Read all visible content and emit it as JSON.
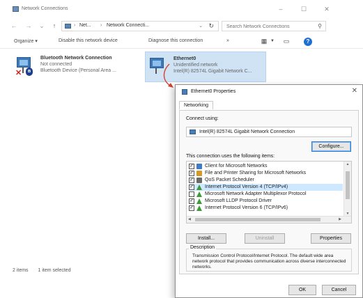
{
  "window": {
    "title": "Network Connections",
    "controls": {
      "minimize": "–",
      "maximize": "☐",
      "close": "✕"
    }
  },
  "nav": {
    "back": "←",
    "forward": "→",
    "recent": "⌄",
    "up": "↑"
  },
  "address": {
    "crumbs": [
      "Net...",
      "Network Connecti..."
    ],
    "separator": "›",
    "dropdown": "⌄",
    "refresh": "↻"
  },
  "search": {
    "placeholder": "Search Network Connections",
    "icon": "search-icon"
  },
  "toolbar": {
    "organize": "Organize ▾",
    "disable": "Disable this network device",
    "diagnose": "Diagnose this connection",
    "more": "»",
    "help": "?"
  },
  "connections": [
    {
      "name": "Bluetooth Network Connection",
      "status": "Not connected",
      "device": "Bluetooth Device (Personal Area ...",
      "icon": "bluetooth-network-icon"
    },
    {
      "name": "Ethernet0",
      "status": "Unidentified network",
      "device": "Intel(R) 82574L Gigabit Network C...",
      "icon": "ethernet-icon"
    }
  ],
  "statusbar": {
    "items_count": "2 items",
    "selected": "1 item selected"
  },
  "dialog": {
    "title": "Ethernet0 Properties",
    "close": "✕",
    "tab": "Networking",
    "connect_using_label": "Connect using:",
    "adapter": "Intel(R) 82574L Gigabit Network Connection",
    "configure_button": "Configure...",
    "items_label": "This connection uses the following items:",
    "items": [
      {
        "label": "Client for Microsoft Networks",
        "checked": true,
        "icon": "client"
      },
      {
        "label": "File and Printer Sharing for Microsoft Networks",
        "checked": true,
        "icon": "share"
      },
      {
        "label": "QoS Packet Scheduler",
        "checked": true,
        "icon": "qos"
      },
      {
        "label": "Internet Protocol Version 4 (TCP/IPv4)",
        "checked": true,
        "icon": "proto",
        "selected": true
      },
      {
        "label": "Microsoft Network Adapter Multiplexor Protocol",
        "checked": false,
        "icon": "proto"
      },
      {
        "label": "Microsoft LLDP Protocol Driver",
        "checked": true,
        "icon": "proto"
      },
      {
        "label": "Internet Protocol Version 6 (TCP/IPv6)",
        "checked": true,
        "icon": "proto"
      }
    ],
    "install_button": "Install...",
    "uninstall_button": "Uninstall",
    "properties_button": "Properties",
    "description_label": "Description",
    "description": "Transmission Control Protocol/Internet Protocol. The default wide area network protocol that provides communication across diverse interconnected networks.",
    "ok_button": "OK",
    "cancel_button": "Cancel"
  },
  "colors": {
    "selection": "#cde8ff",
    "selected_tile": "#cfe3f5",
    "accent": "#1f6fd2",
    "arrow": "#d6412e"
  }
}
